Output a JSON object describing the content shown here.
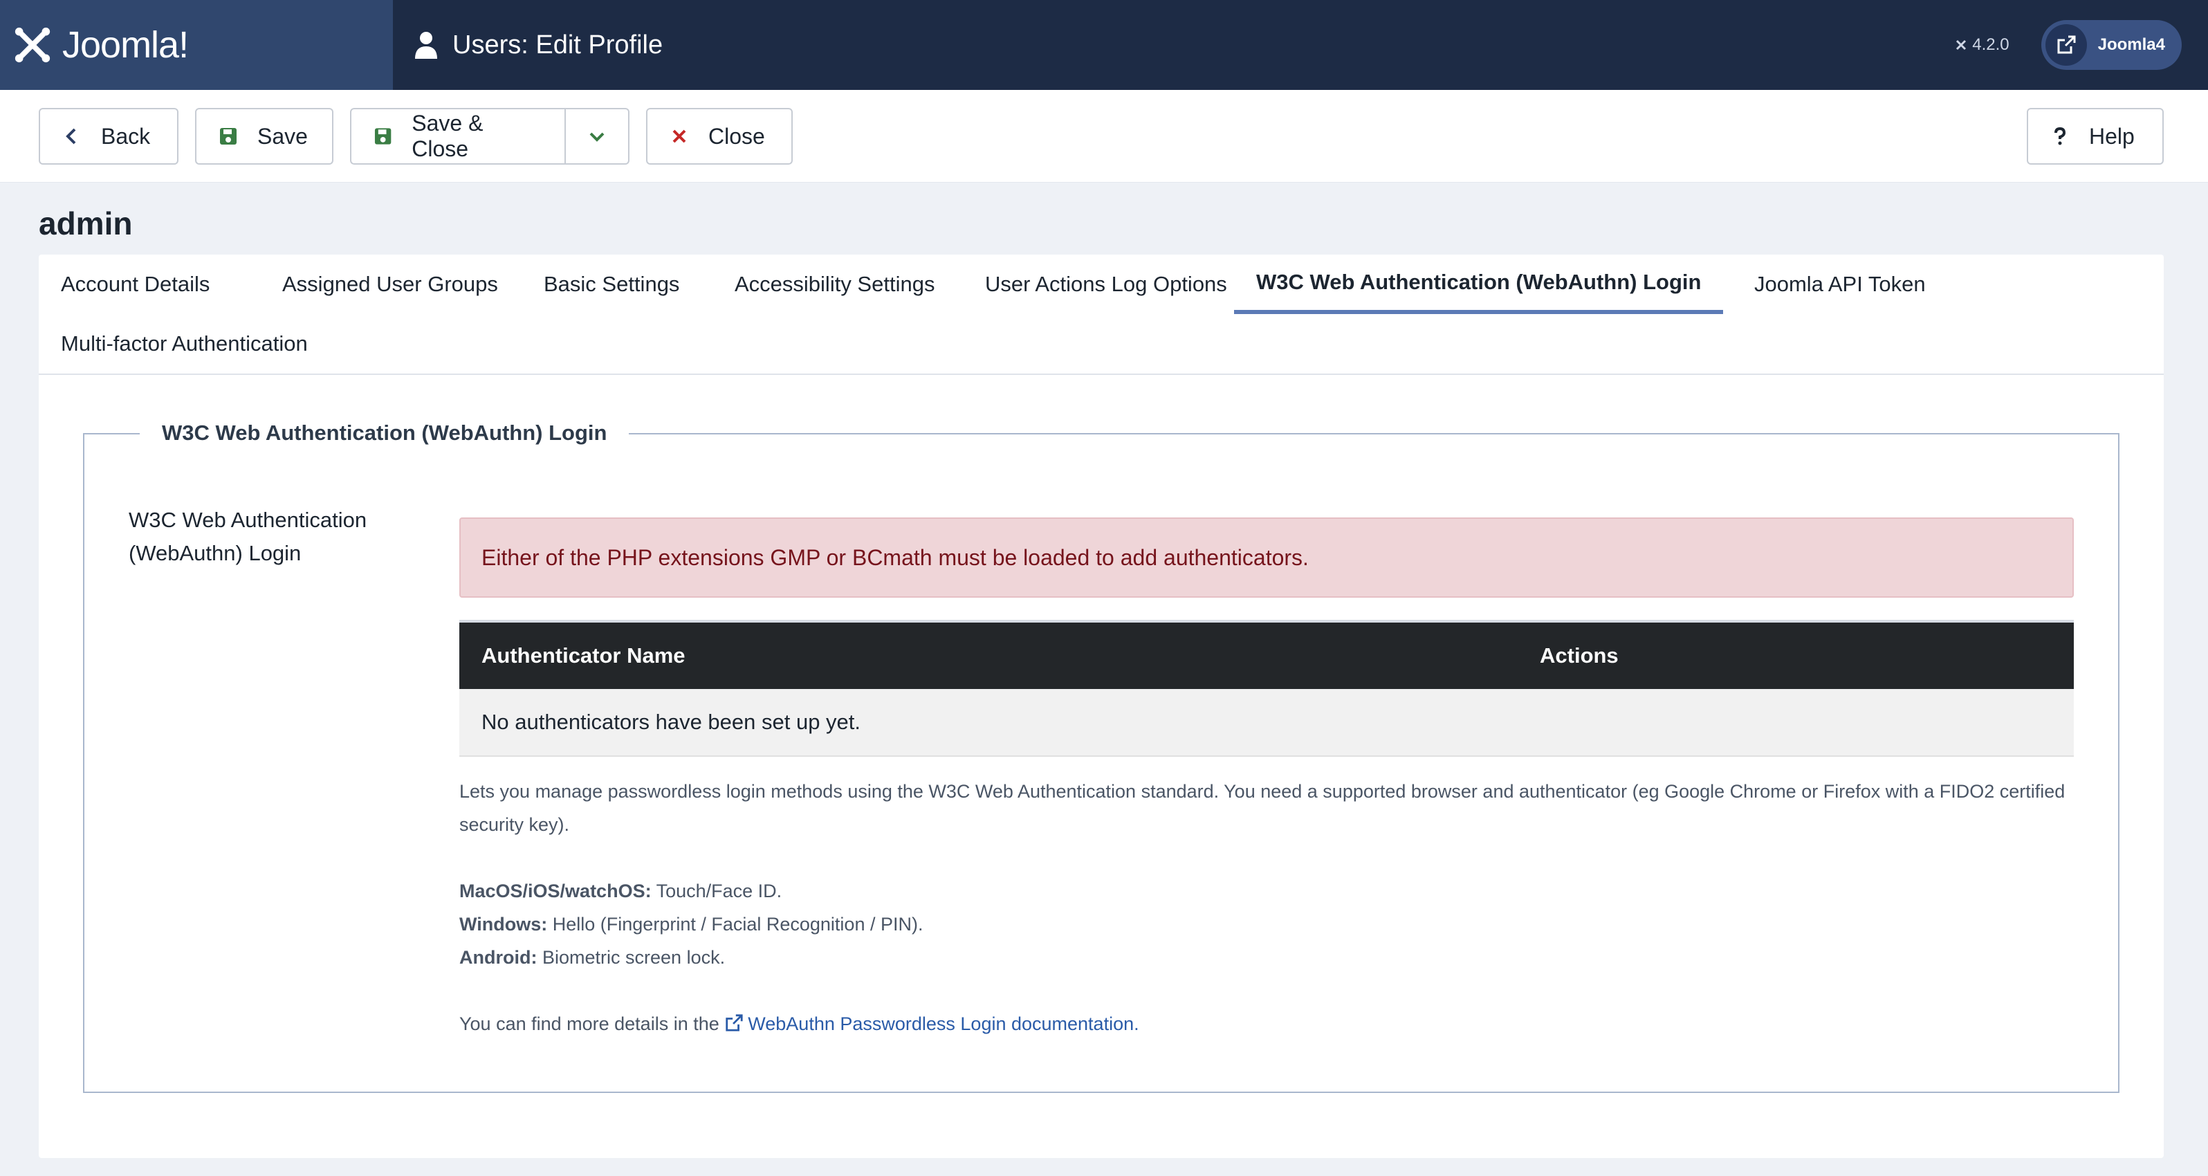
{
  "brand": {
    "name": "Joomla!"
  },
  "header": {
    "title": "Users: Edit Profile",
    "version": "4.2.0",
    "user_label": "Joomla4"
  },
  "toolbar": {
    "back": "Back",
    "save": "Save",
    "save_close": "Save & Close",
    "close": "Close",
    "help": "Help"
  },
  "user": {
    "name": "admin"
  },
  "tabs": [
    "Account Details",
    "Assigned User Groups",
    "Basic Settings",
    "Accessibility Settings",
    "User Actions Log Options",
    "W3C Web Authentication (WebAuthn) Login",
    "Joomla API Token",
    "Multi-factor Authentication"
  ],
  "active_tab": "W3C Web Authentication (WebAuthn) Login",
  "fieldset": {
    "legend": "W3C Web Authentication (WebAuthn) Login",
    "label_line1": "W3C Web Authentication",
    "label_line2": "(WebAuthn) Login"
  },
  "alert": {
    "message": "Either of the PHP extensions GMP or BCmath must be loaded to add authenticators."
  },
  "table": {
    "headers": [
      "Authenticator Name",
      "Actions"
    ],
    "empty_message": "No authenticators have been set up yet."
  },
  "description": {
    "intro": "Lets you manage passwordless login methods using the W3C Web Authentication standard. You need a supported browser and authenticator (eg Google Chrome or Firefox with a FIDO2 certified security key).",
    "platforms": [
      {
        "name": "MacOS/iOS/watchOS:",
        "value": "Touch/Face ID."
      },
      {
        "name": "Windows:",
        "value": "Hello (Fingerprint / Facial Recognition / PIN)."
      },
      {
        "name": "Android:",
        "value": "Biometric screen lock."
      }
    ],
    "more_prefix": "You can find more details in the",
    "more_link": "WebAuthn Passwordless Login documentation."
  },
  "colors": {
    "header_bg": "#1d2b45",
    "logo_bg": "#30476e",
    "active_tab_border": "#5b7ab6",
    "alert_bg": "#efd5d8",
    "alert_text": "#76141c",
    "table_head_bg": "#232629",
    "save_icon": "#3a7d44",
    "close_icon": "#c52827",
    "link": "#2a5ba8"
  },
  "icons": {
    "brand": "joomla-logo-icon",
    "title": "user-icon",
    "version": "joomla-mini-icon",
    "user_pill": "external-link-icon",
    "back": "chevron-left-icon",
    "save": "floppy-disk-icon",
    "save_close": "floppy-disk-icon",
    "dropdown": "chevron-down-icon",
    "close": "x-icon",
    "help": "question-icon",
    "doc_link": "external-link-icon"
  }
}
